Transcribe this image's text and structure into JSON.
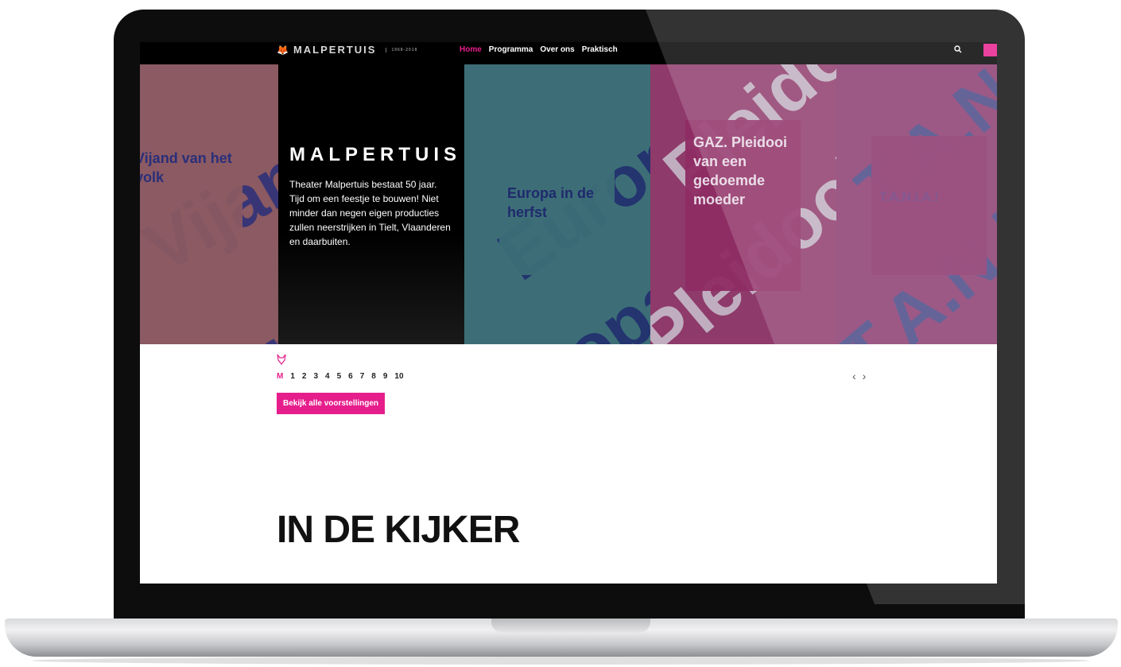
{
  "nav": {
    "logo": "MALPERTUIS",
    "logo_sub": "1968-2018",
    "items": [
      "Home",
      "Programma",
      "Over ons",
      "Praktisch"
    ],
    "active": "Home",
    "search_icon": "search-icon"
  },
  "hero": {
    "intro_title": "MALPERTUIS",
    "intro_text": "Theater Malpertuis bestaat 50 jaar. Tijd om een feestje te bouwen! Niet minder dan negen eigen producties zullen neerstrijken in Tielt, Vlaanderen en daarbuiten.",
    "productions": [
      {
        "title": "Vijand van het volk",
        "bg_text": "Vijand van het volk",
        "color": "#8b5a62"
      },
      {
        "title": "Europa in de herfst",
        "bg_text": "Europa in de herfst",
        "color": "#3d6e77"
      },
      {
        "title": "GAZ. Pleidooi van een gedoemde moeder",
        "bg_text": "Pleidooi",
        "color": "#8e3a6a"
      },
      {
        "title": "T.A.N.I.A.!",
        "bg_text": "T.A.N.I.A.!",
        "color": "#8a3a6f"
      }
    ]
  },
  "pager": {
    "current": "M",
    "pages": [
      "1",
      "2",
      "3",
      "4",
      "5",
      "6",
      "7",
      "8",
      "9",
      "10"
    ],
    "prev": "‹",
    "next": "›"
  },
  "cta_label": "Bekijk alle voorstellingen",
  "section_title": "IN DE KIJKER",
  "colors": {
    "accent": "#e61e8c",
    "bezel": "#0d0d0e"
  }
}
